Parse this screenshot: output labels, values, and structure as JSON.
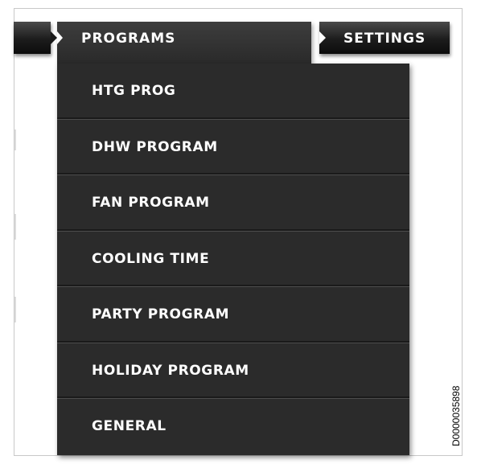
{
  "menubar": {
    "tabs": [
      {
        "label": ""
      },
      {
        "label": "PROGRAMS"
      },
      {
        "label": "SETTINGS"
      }
    ]
  },
  "dropdown": {
    "items": [
      {
        "label": "HTG PROG"
      },
      {
        "label": "DHW PROGRAM"
      },
      {
        "label": "FAN PROGRAM"
      },
      {
        "label": "COOLING TIME"
      },
      {
        "label": "PARTY PROGRAM"
      },
      {
        "label": "HOLIDAY PROGRAM"
      },
      {
        "label": "GENERAL"
      }
    ]
  },
  "figure": {
    "doc_id": "D0000035898"
  },
  "colors": {
    "menu_bg": "#2b2b2b",
    "tab_dark": "#0c0c0c",
    "text": "#ffffff",
    "divider": "#4d4d4d"
  }
}
